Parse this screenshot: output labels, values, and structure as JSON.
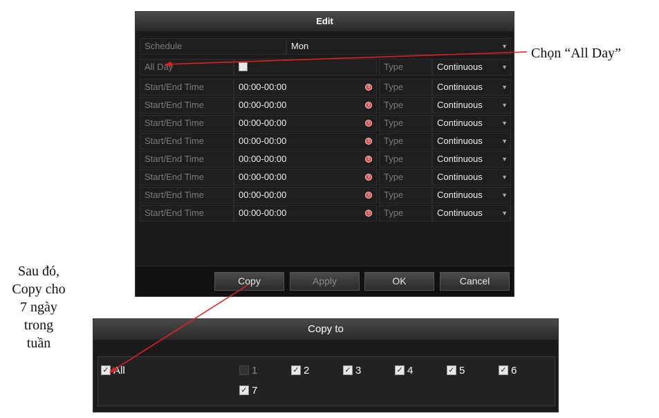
{
  "edit_dialog": {
    "title": "Edit",
    "schedule_label": "Schedule",
    "schedule_value": "Mon",
    "all_day_label": "All Day",
    "type_label": "Type",
    "type_value": "Continuous",
    "rows": [
      {
        "label": "Start/End Time",
        "time": "00:00-00:00",
        "type_label": "Type",
        "type_value": "Continuous"
      },
      {
        "label": "Start/End Time",
        "time": "00:00-00:00",
        "type_label": "Type",
        "type_value": "Continuous"
      },
      {
        "label": "Start/End Time",
        "time": "00:00-00:00",
        "type_label": "Type",
        "type_value": "Continuous"
      },
      {
        "label": "Start/End Time",
        "time": "00:00-00:00",
        "type_label": "Type",
        "type_value": "Continuous"
      },
      {
        "label": "Start/End Time",
        "time": "00:00-00:00",
        "type_label": "Type",
        "type_value": "Continuous"
      },
      {
        "label": "Start/End Time",
        "time": "00:00-00:00",
        "type_label": "Type",
        "type_value": "Continuous"
      },
      {
        "label": "Start/End Time",
        "time": "00:00-00:00",
        "type_label": "Type",
        "type_value": "Continuous"
      },
      {
        "label": "Start/End Time",
        "time": "00:00-00:00",
        "type_label": "Type",
        "type_value": "Continuous"
      }
    ],
    "buttons": {
      "copy": "Copy",
      "apply": "Apply",
      "ok": "OK",
      "cancel": "Cancel"
    }
  },
  "copy_dialog": {
    "title": "Copy to",
    "all_label": "All",
    "days": [
      {
        "label": "1",
        "checked": false,
        "disabled": true
      },
      {
        "label": "2",
        "checked": true,
        "disabled": false
      },
      {
        "label": "3",
        "checked": true,
        "disabled": false
      },
      {
        "label": "4",
        "checked": true,
        "disabled": false
      },
      {
        "label": "5",
        "checked": true,
        "disabled": false
      },
      {
        "label": "6",
        "checked": true,
        "disabled": false
      },
      {
        "label": "7",
        "checked": true,
        "disabled": false
      }
    ]
  },
  "annotations": {
    "right_note": "Chọn “All Day”",
    "left_note": [
      "Sau đó,",
      "Copy cho",
      "7 ngày",
      "trong",
      "tuần"
    ],
    "arrow_color": "#e02020"
  },
  "icons": {
    "dropdown": "chevron-down-icon",
    "time": "clock-icon",
    "check": "check-icon"
  }
}
